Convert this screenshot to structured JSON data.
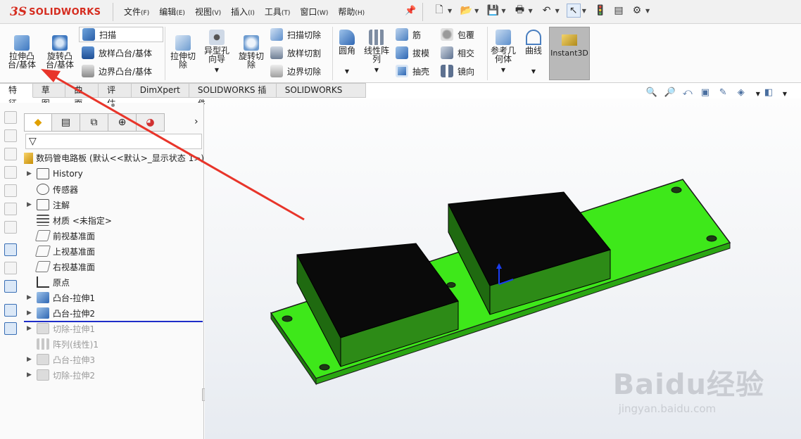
{
  "app": {
    "logo_ds": "3S",
    "logo_name": "SOLIDWORKS"
  },
  "menu": {
    "items": [
      {
        "label": "文件",
        "key": "(F)"
      },
      {
        "label": "编辑",
        "key": "(E)"
      },
      {
        "label": "视图",
        "key": "(V)"
      },
      {
        "label": "插入",
        "key": "(I)"
      },
      {
        "label": "工具",
        "key": "(T)"
      },
      {
        "label": "窗口",
        "key": "(W)"
      },
      {
        "label": "帮助",
        "key": "(H)"
      }
    ]
  },
  "ribbon": {
    "extrude_boss": "拉伸凸台/基体",
    "revolve_boss": "旋转凸台/基体",
    "sweep": "扫描",
    "loft_boss": "放样凸台/基体",
    "boundary_boss": "边界凸台/基体",
    "extrude_cut": "拉伸切除",
    "hole_wizard": "异型孔向导",
    "revolve_cut": "旋转切除",
    "sweep_cut": "扫描切除",
    "loft_cut": "放样切割",
    "boundary_cut": "边界切除",
    "fillet": "圆角",
    "linear_pattern": "线性阵列",
    "rib": "筋",
    "draft": "拔模",
    "shell": "抽壳",
    "wrap": "包覆",
    "intersect": "相交",
    "mirror": "镜向",
    "ref_geometry": "参考几何体",
    "curves": "曲线",
    "instant3d": "Instant3D"
  },
  "tabs": [
    "特征",
    "草图",
    "曲面",
    "评估",
    "DimXpert",
    "SOLIDWORKS 插件",
    "SOLIDWORKS MBD"
  ],
  "tree": {
    "root": "数码管电路板 (默认<<默认>_显示状态 1>)",
    "items": [
      {
        "label": "History",
        "expandable": true,
        "dim": false
      },
      {
        "label": "传感器",
        "expandable": false,
        "dim": false
      },
      {
        "label": "注解",
        "expandable": true,
        "dim": false
      },
      {
        "label": "材质 <未指定>",
        "expandable": false,
        "dim": false
      },
      {
        "label": "前视基准面",
        "expandable": false,
        "dim": false
      },
      {
        "label": "上视基准面",
        "expandable": false,
        "dim": false
      },
      {
        "label": "右视基准面",
        "expandable": false,
        "dim": false
      },
      {
        "label": "原点",
        "expandable": false,
        "dim": false
      },
      {
        "label": "凸台-拉伸1",
        "expandable": true,
        "dim": false
      },
      {
        "label": "凸台-拉伸2",
        "expandable": true,
        "dim": false
      },
      {
        "label": "切除-拉伸1",
        "expandable": true,
        "dim": true
      },
      {
        "label": "阵列(线性)1",
        "expandable": false,
        "dim": true
      },
      {
        "label": "凸台-拉伸3",
        "expandable": true,
        "dim": true
      },
      {
        "label": "切除-拉伸2",
        "expandable": true,
        "dim": true
      }
    ]
  },
  "watermark": {
    "brand": "Baidu经验",
    "url": "jingyan.baidu.com"
  },
  "colors": {
    "board": "#3ee81a",
    "block": "#0a0a0a",
    "arrow": "#e8352a",
    "logo": "#d52b1e"
  }
}
